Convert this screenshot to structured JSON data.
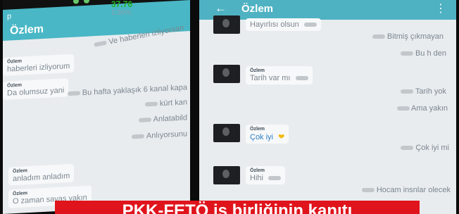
{
  "ticker": {
    "value": "37.76",
    "percent": "1.50%"
  },
  "left_phone": {
    "status_letter": "p",
    "contact_name": "Özlem",
    "messages": [
      {
        "dir": "out",
        "text": "Ve haberleri izliyorsan"
      },
      {
        "dir": "in",
        "name": "Özlem",
        "text": "haberleri izliyorum"
      },
      {
        "dir": "in",
        "name": "Özlem",
        "text": "Da olumsuz yani"
      },
      {
        "dir": "out",
        "text": "Bu hafta yaklaşık 6 kanal kapa"
      },
      {
        "dir": "out",
        "text": "kürt kan"
      },
      {
        "dir": "out",
        "text": "Anlatabild"
      },
      {
        "dir": "out",
        "text": "Anlıyorsunu"
      },
      {
        "dir": "in",
        "name": "Özlem",
        "text": "anladım anladım"
      },
      {
        "dir": "in",
        "name": "Özlem",
        "text": "O zaman savaş yakın"
      }
    ]
  },
  "right_phone": {
    "back_icon": "arrow-left-icon",
    "contact_name": "Özlem",
    "menu_icon": "overflow-menu-icon",
    "messages": [
      {
        "dir": "in",
        "text": "Hayırlısı olsun"
      },
      {
        "dir": "out",
        "text": "Bitmiş çıkmayan"
      },
      {
        "dir": "out",
        "text": "Bu h    den"
      },
      {
        "dir": "in",
        "name": "Özlem",
        "text": "Tarih var mı"
      },
      {
        "dir": "out",
        "text": "Tarih yok"
      },
      {
        "dir": "out",
        "text": "Ama yakın"
      },
      {
        "dir": "in",
        "name": "Özlem",
        "text": "Çok iyi"
      },
      {
        "dir": "out",
        "text": "Çok iyi mi"
      },
      {
        "dir": "in",
        "name": "Özlem",
        "text": "Hihi"
      },
      {
        "dir": "out",
        "text": "Hocam insnlar olecek"
      }
    ]
  },
  "caption": "PKK-FETÖ iş birliğinin kanıtı"
}
